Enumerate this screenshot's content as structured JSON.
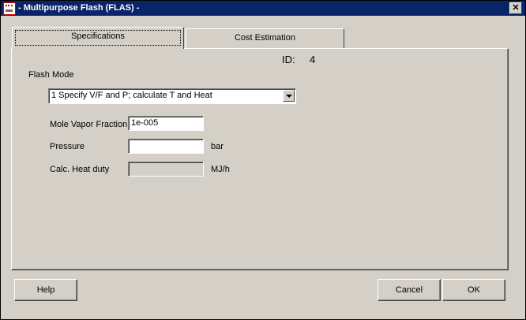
{
  "window": {
    "title": "- Multipurpose Flash (FLAS) -",
    "close_glyph": "✕"
  },
  "tabs": [
    {
      "label": "Specifications"
    },
    {
      "label": "Cost Estimation"
    }
  ],
  "id": {
    "label": "ID:",
    "value": "4"
  },
  "flash_mode": {
    "label": "Flash Mode",
    "selected": "1 Specify V/F  and P; calculate T and Heat"
  },
  "fields": [
    {
      "label": "Mole Vapor Fraction",
      "value": "1e-005",
      "unit": ""
    },
    {
      "label": "Pressure",
      "value": "",
      "unit": "bar"
    },
    {
      "label": "Calc. Heat duty",
      "value": "",
      "unit": "MJ/h"
    }
  ],
  "buttons": {
    "help": "Help",
    "cancel": "Cancel",
    "ok": "OK"
  }
}
